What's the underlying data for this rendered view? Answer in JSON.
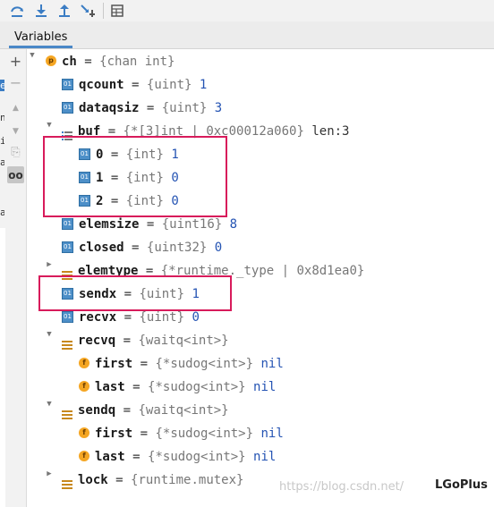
{
  "toolbar": {
    "buttons": [
      {
        "icon": "step-over-icon"
      },
      {
        "icon": "step-into-icon"
      },
      {
        "icon": "step-out-icon"
      },
      {
        "icon": "run-to-cursor-icon"
      },
      {
        "icon": "evaluate-expression-icon"
      }
    ]
  },
  "tabs": {
    "variables": "Variables"
  },
  "gutter": {
    "buttons": [
      {
        "icon": "add-icon",
        "glyph": "+"
      },
      {
        "icon": "remove-icon",
        "glyph": "−"
      },
      {
        "icon": "move-up-icon",
        "glyph": "▲"
      },
      {
        "icon": "move-down-icon",
        "glyph": "▼"
      },
      {
        "icon": "copy-icon",
        "glyph": "⎘"
      },
      {
        "icon": "glasses-icon",
        "glyph": "oo"
      }
    ]
  },
  "left_strip": [
    "e",
    "n",
    "ir",
    "a",
    "a"
  ],
  "tree": [
    {
      "name": "ch",
      "type": "{chan int}",
      "value": "",
      "icon": "p"
    },
    {
      "name": "qcount",
      "type": "{uint}",
      "value": "1",
      "icon": "int"
    },
    {
      "name": "dataqsiz",
      "type": "{uint}",
      "value": "3",
      "icon": "int"
    },
    {
      "name": "buf",
      "type": "{*[3]int | 0xc00012a060}",
      "value": "len:3",
      "icon": "struct"
    },
    {
      "name": "0",
      "type": "{int}",
      "value": "1",
      "icon": "int"
    },
    {
      "name": "1",
      "type": "{int}",
      "value": "0",
      "icon": "int"
    },
    {
      "name": "2",
      "type": "{int}",
      "value": "0",
      "icon": "int"
    },
    {
      "name": "elemsize",
      "type": "{uint16}",
      "value": "8",
      "icon": "int"
    },
    {
      "name": "closed",
      "type": "{uint32}",
      "value": "0",
      "icon": "int"
    },
    {
      "name": "elemtype",
      "type": "{*runtime._type | 0x8d1ea0}",
      "value": "",
      "icon": "struct"
    },
    {
      "name": "sendx",
      "type": "{uint}",
      "value": "1",
      "icon": "int"
    },
    {
      "name": "recvx",
      "type": "{uint}",
      "value": "0",
      "icon": "int"
    },
    {
      "name": "recvq",
      "type": "{waitq<int>}",
      "value": "",
      "icon": "struct"
    },
    {
      "name": "first",
      "type": "{*sudog<int>}",
      "value": "nil",
      "icon": "f"
    },
    {
      "name": "last",
      "type": "{*sudog<int>}",
      "value": "nil",
      "icon": "f"
    },
    {
      "name": "sendq",
      "type": "{waitq<int>}",
      "value": "",
      "icon": "struct"
    },
    {
      "name": "first",
      "type": "{*sudog<int>}",
      "value": "nil",
      "icon": "f"
    },
    {
      "name": "last",
      "type": "{*sudog<int>}",
      "value": "nil",
      "icon": "f"
    },
    {
      "name": "lock",
      "type": "{runtime.mutex}",
      "value": "",
      "icon": "struct"
    }
  ],
  "icon_labels": {
    "int": "01",
    "p": "p",
    "f": "f"
  },
  "equals": "=",
  "watermark": "https://blog.csdn.net/",
  "brand": "LGoPlus",
  "colors": {
    "highlight": "#d81b5b",
    "value": "#2453b3",
    "type": "#777777",
    "int_icon": "#4d8fc8"
  }
}
